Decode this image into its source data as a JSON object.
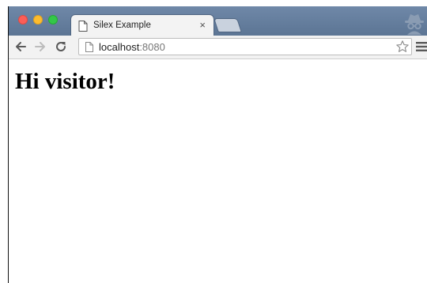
{
  "tab": {
    "title": "Silex Example",
    "close_label": "×",
    "favicon": "page-icon"
  },
  "window_controls": [
    "close",
    "minimize",
    "maximize"
  ],
  "toolbar": {
    "icons": [
      "back-arrow-icon",
      "forward-arrow-icon",
      "reload-icon",
      "page-icon",
      "star-icon",
      "menu-icon"
    ]
  },
  "address_bar": {
    "host": "localhost",
    "port": ":8080"
  },
  "profile": {
    "icon": "incognito-icon"
  },
  "page": {
    "heading": "Hi visitor!"
  },
  "colors": {
    "titlebar": "#6f88a8",
    "tab_bg": "#f3f3f3",
    "toolbar_bg": "#f2f2f2",
    "close_red": "#fc5e57",
    "min_yellow": "#fdbc2e",
    "max_green": "#33c748"
  }
}
